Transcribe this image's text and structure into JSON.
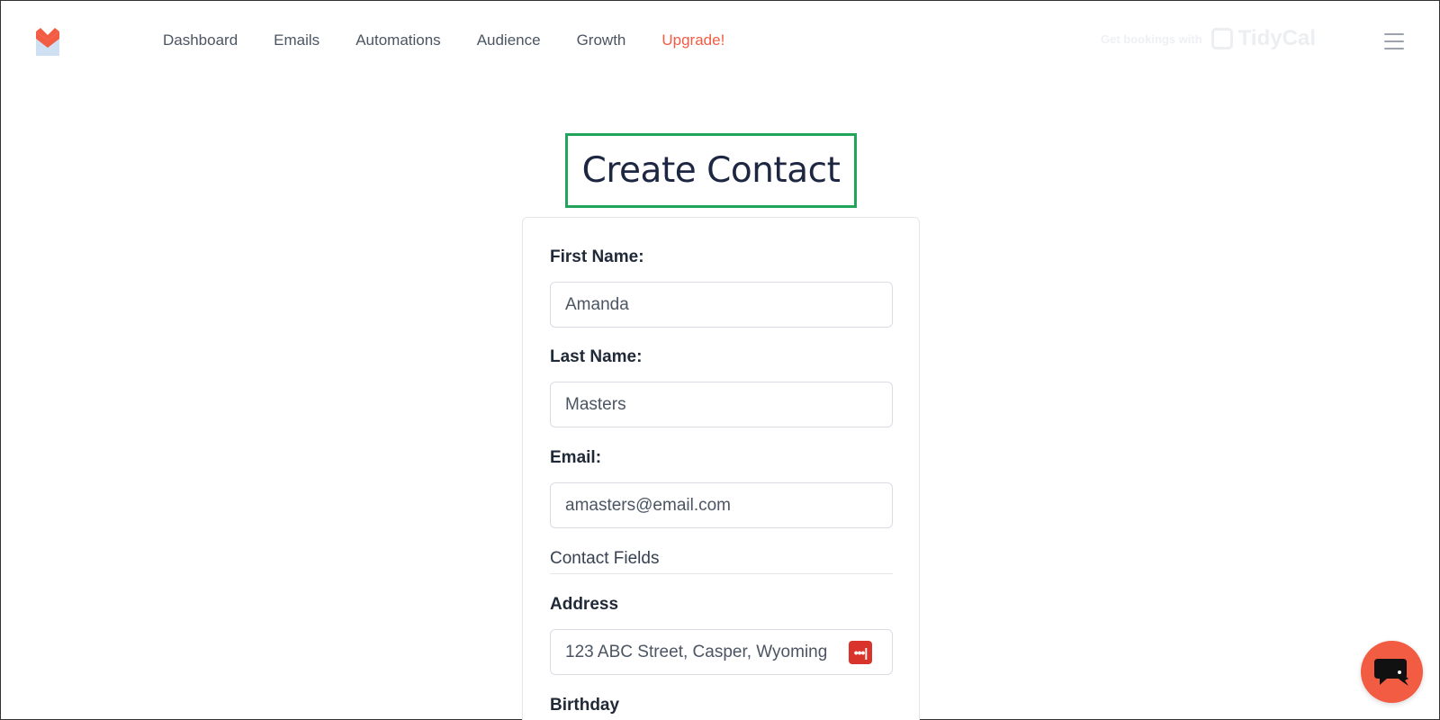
{
  "nav": {
    "items": [
      {
        "label": "Dashboard"
      },
      {
        "label": "Emails"
      },
      {
        "label": "Automations"
      },
      {
        "label": "Audience"
      },
      {
        "label": "Growth"
      },
      {
        "label": "Upgrade!"
      }
    ]
  },
  "promo": {
    "text": "Get bookings with",
    "brand": "TidyCal"
  },
  "page": {
    "title": "Create Contact"
  },
  "form": {
    "first_name": {
      "label": "First Name:",
      "value": "Amanda"
    },
    "last_name": {
      "label": "Last Name:",
      "value": "Masters"
    },
    "email": {
      "label": "Email:",
      "value": "amasters@email.com"
    },
    "section_title": "Contact Fields",
    "address": {
      "label": "Address",
      "value": "123 ABC Street, Casper, Wyoming",
      "badge": "•••|"
    },
    "birthday": {
      "label": "Birthday"
    }
  },
  "colors": {
    "accent": "#f25c43",
    "title_border": "#22a55b"
  }
}
